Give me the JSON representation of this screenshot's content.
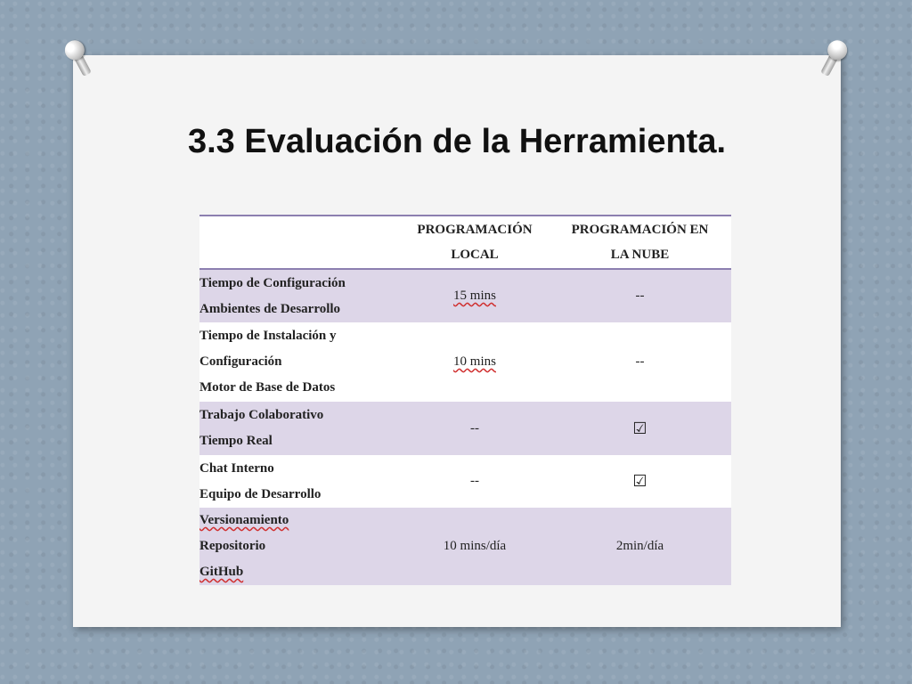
{
  "slide": {
    "title": "3.3 Evaluación de la Herramienta."
  },
  "table": {
    "headers": {
      "local_line1": "PROGRAMACIÓN",
      "local_line2": "LOCAL",
      "cloud_line1": "PROGRAMACIÓN EN",
      "cloud_line2": "LA NUBE"
    },
    "rows": [
      {
        "label_lines": [
          "Tiempo de Configuración",
          "Ambientes de Desarrollo"
        ],
        "local": "15 mins",
        "cloud": "--"
      },
      {
        "label_lines": [
          "Tiempo de Instalación y",
          "Configuración",
          "Motor de Base de Datos"
        ],
        "local": "10 mins",
        "cloud": "--"
      },
      {
        "label_lines": [
          "Trabajo Colaborativo",
          "Tiempo Real"
        ],
        "local": "--",
        "cloud": "☑"
      },
      {
        "label_lines": [
          "Chat Interno",
          "Equipo  de Desarrollo"
        ],
        "local": "--",
        "cloud": "☑"
      },
      {
        "label_lines": [
          "Versionamiento",
          "Repositorio",
          "GitHub"
        ],
        "local": "10 mins/día",
        "cloud": "2min/día"
      }
    ]
  },
  "colors": {
    "header_border": "#8c7fb0",
    "row_shade": "#ddd6e8",
    "background": "#8fa3b5"
  }
}
